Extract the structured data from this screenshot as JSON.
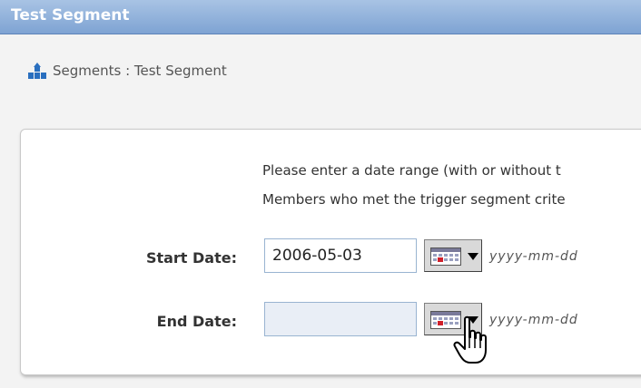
{
  "window": {
    "title": "Test Segment"
  },
  "breadcrumb": {
    "icon": "segments-icon",
    "text": "Segments : Test Segment"
  },
  "instructions": {
    "line1": "Please enter a date range (with or without t",
    "line2": "Members who met the trigger segment crite"
  },
  "start_date": {
    "label": "Start Date:",
    "value": "2006-05-03",
    "format_hint": "yyyy-mm-dd",
    "calendar_icon": "calendar-icon"
  },
  "end_date": {
    "label": "End Date:",
    "value": "",
    "format_hint": "yyyy-mm-dd",
    "calendar_icon": "calendar-icon"
  },
  "colors": {
    "titlebar": "#7ea3d3",
    "icon_blue": "#2a6fbf",
    "input_border": "#99b4d1"
  }
}
